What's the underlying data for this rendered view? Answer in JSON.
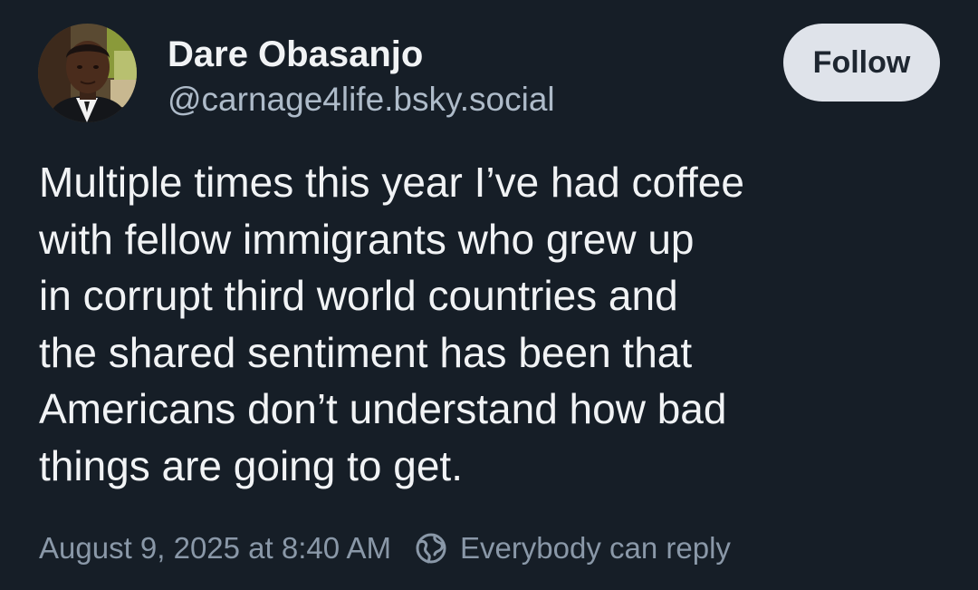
{
  "author": {
    "display_name": "Dare Obasanjo",
    "handle": "@carnage4life.bsky.social",
    "avatar_icon": "profile-photo"
  },
  "actions": {
    "follow_label": "Follow"
  },
  "post": {
    "lines": [
      "Multiple times this year I’ve had coffee",
      "with fellow immigrants who grew up",
      "in corrupt third world countries and",
      "the shared sentiment has been that",
      "Americans don’t understand how bad",
      "things are going to get."
    ]
  },
  "meta": {
    "timestamp": "August 9, 2025 at 8:40 AM",
    "reply_setting": "Everybody can reply",
    "reply_icon": "globe-icon"
  },
  "colors": {
    "background": "#161e27",
    "text_primary": "#f1f3f5",
    "text_secondary": "#aebbc9",
    "text_muted": "#8a98a8",
    "follow_button_bg": "#dfe3ea"
  }
}
